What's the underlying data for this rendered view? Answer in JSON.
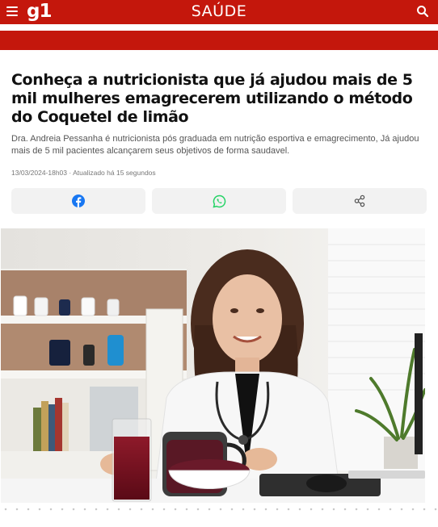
{
  "header": {
    "logo": "g1",
    "section": "SAÚDE",
    "menu_icon": "hamburger-icon",
    "search_icon": "search-icon",
    "brand_color": "#c4170c"
  },
  "article": {
    "headline": "Conheça a nutricionista que já ajudou mais de 5 mil mulheres emagrecerem utilizando o método do Coquetel de limão",
    "subtitle": "Dra. Andreia Pessanha é nutricionista pós graduada em nutrição esportiva e emagrecimento, Já ajudou mais de 5 mil pacientes alcançarem seus objetivos de forma saudavel.",
    "meta": "13/03/2024-18h03 · Atualizado há 15 segundos"
  },
  "share": {
    "buttons": [
      {
        "icon": "facebook-icon",
        "color": "#1877f2"
      },
      {
        "icon": "whatsapp-icon",
        "color": "#25d366"
      },
      {
        "icon": "share-icon",
        "color": "#555555"
      }
    ]
  },
  "hero": {
    "subject": "nutritionist-photo"
  }
}
